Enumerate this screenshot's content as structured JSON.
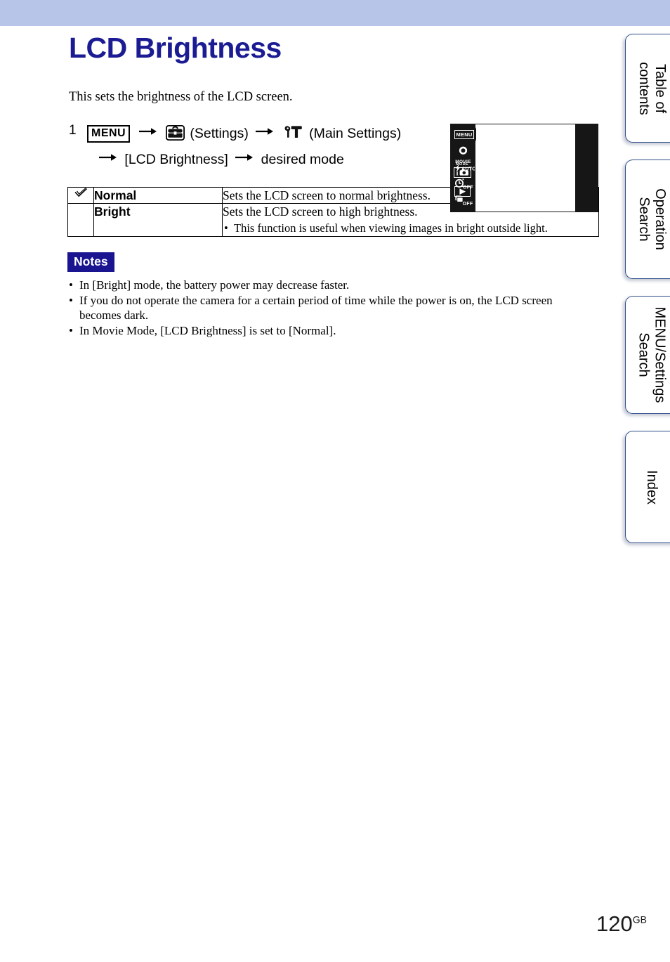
{
  "banner": {
    "color": "#b7c5e9"
  },
  "header": {
    "title": "LCD Brightness",
    "title_color": "#1b1b93"
  },
  "intro": "This sets the brightness of the LCD screen.",
  "step": {
    "number": "1",
    "menu_chip": "MENU",
    "settings_label": "(Settings)",
    "main_settings_label": "(Main Settings)",
    "bracket_item": "[LCD Brightness]",
    "desired_mode": "desired mode",
    "arrow": "→"
  },
  "lcd_figure": {
    "menu_button": "MENU",
    "left_icons": [
      {
        "name": "movie-mode-icon",
        "label": "MOVIE"
      },
      {
        "name": "flash-auto-icon",
        "label": "AUTO"
      },
      {
        "name": "self-timer-icon",
        "label": "OFF"
      },
      {
        "name": "burst-mode-icon",
        "label": "OFF"
      }
    ],
    "mode_label": "MODE",
    "mode_icon_text": "i",
    "playback_icon": "▶"
  },
  "table": {
    "rows": [
      {
        "checked": true,
        "check_glyph": "✓",
        "name": "Normal",
        "description": "Sets the LCD screen to normal brightness.",
        "sub": null
      },
      {
        "checked": false,
        "check_glyph": "",
        "name": "Bright",
        "description": "Sets the LCD screen to high brightness.",
        "sub": "This function is useful when viewing images in bright outside light."
      }
    ]
  },
  "notes": {
    "badge": "Notes",
    "badge_color": "#1a1490",
    "items": [
      "In [Bright] mode, the battery power may decrease faster.",
      "If you do not operate the camera for a certain period of time while the power is on, the LCD screen becomes dark.",
      "In Movie Mode, [LCD Brightness] is set to [Normal]."
    ]
  },
  "side_tabs": [
    {
      "line1": "Table of",
      "line2": "contents"
    },
    {
      "line1": "Operation",
      "line2": "Search"
    },
    {
      "line1": "MENU/Settings",
      "line2": "Search"
    },
    {
      "line1": "Index",
      "line2": ""
    }
  ],
  "footer": {
    "page_number": "120",
    "page_suffix": "GB"
  }
}
